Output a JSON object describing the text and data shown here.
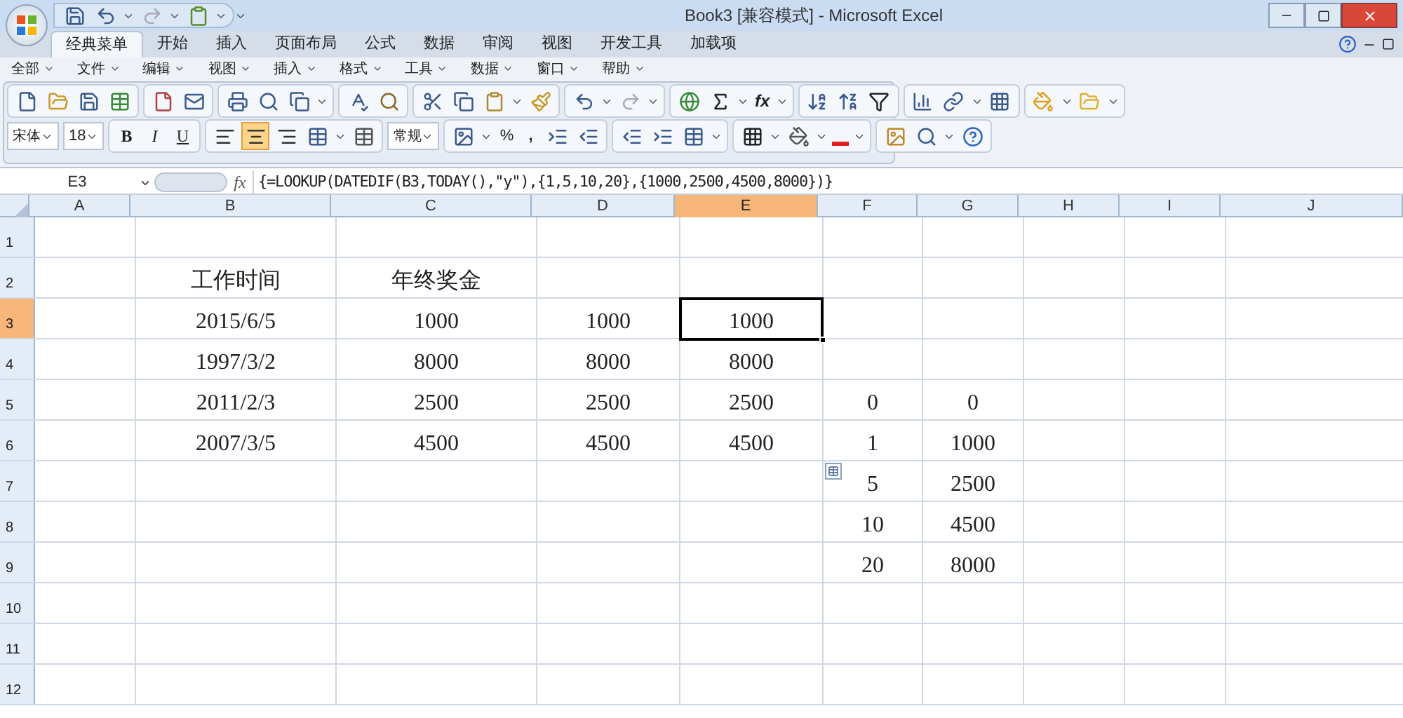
{
  "window": {
    "title": "Book3  [兼容模式] - Microsoft Excel"
  },
  "tabs": [
    {
      "label": "经典菜单",
      "selected": true
    },
    {
      "label": "开始",
      "selected": false
    },
    {
      "label": "插入",
      "selected": false
    },
    {
      "label": "页面布局",
      "selected": false
    },
    {
      "label": "公式",
      "selected": false
    },
    {
      "label": "数据",
      "selected": false
    },
    {
      "label": "审阅",
      "selected": false
    },
    {
      "label": "视图",
      "selected": false
    },
    {
      "label": "开发工具",
      "selected": false
    },
    {
      "label": "加载项",
      "selected": false
    }
  ],
  "menu": [
    "全部",
    "文件",
    "编辑",
    "视图",
    "插入",
    "格式",
    "工具",
    "数据",
    "窗口",
    "帮助"
  ],
  "format_bar": {
    "function_button": "fx",
    "font": "宋体",
    "size": "18",
    "bold": "B",
    "italic": "I",
    "underline": "U",
    "number_format": "常规",
    "percent": "%",
    "comma": ","
  },
  "formula_bar": {
    "name_box": "E3",
    "fx": "fx",
    "formula": "{=LOOKUP(DATEDIF(B3,TODAY(),\"y\"),{1,5,10,20},{1000,2500,4500,8000})}"
  },
  "columns": [
    {
      "label": "A",
      "selected": false
    },
    {
      "label": "B",
      "selected": false
    },
    {
      "label": "C",
      "selected": false
    },
    {
      "label": "D",
      "selected": false
    },
    {
      "label": "E",
      "selected": true
    },
    {
      "label": "F",
      "selected": false
    },
    {
      "label": "G",
      "selected": false
    },
    {
      "label": "H",
      "selected": false
    },
    {
      "label": "I",
      "selected": false
    },
    {
      "label": "J",
      "selected": false
    }
  ],
  "rows": [
    {
      "header": "1",
      "selected": false,
      "cells": [
        null,
        null,
        null,
        null,
        null,
        null,
        null,
        null,
        null,
        null
      ]
    },
    {
      "header": "2",
      "selected": false,
      "cells": [
        null,
        "工作时间",
        "年终奖金",
        null,
        null,
        null,
        null,
        null,
        null,
        null
      ]
    },
    {
      "header": "3",
      "selected": true,
      "cells": [
        null,
        "2015/6/5",
        "1000",
        "1000",
        "1000",
        null,
        null,
        null,
        null,
        null
      ]
    },
    {
      "header": "4",
      "selected": false,
      "cells": [
        null,
        "1997/3/2",
        "8000",
        "8000",
        "8000",
        null,
        null,
        null,
        null,
        null
      ]
    },
    {
      "header": "5",
      "selected": false,
      "cells": [
        null,
        "2011/2/3",
        "2500",
        "2500",
        "2500",
        "0",
        "0",
        null,
        null,
        null
      ]
    },
    {
      "header": "6",
      "selected": false,
      "cells": [
        null,
        "2007/3/5",
        "4500",
        "4500",
        "4500",
        "1",
        "1000",
        null,
        null,
        null
      ]
    },
    {
      "header": "7",
      "selected": false,
      "cells": [
        null,
        null,
        null,
        null,
        null,
        "5",
        "2500",
        null,
        null,
        null
      ]
    },
    {
      "header": "8",
      "selected": false,
      "cells": [
        null,
        null,
        null,
        null,
        null,
        "10",
        "4500",
        null,
        null,
        null
      ]
    },
    {
      "header": "9",
      "selected": false,
      "cells": [
        null,
        null,
        null,
        null,
        null,
        "20",
        "8000",
        null,
        null,
        null
      ]
    },
    {
      "header": "10",
      "selected": false,
      "cells": [
        null,
        null,
        null,
        null,
        null,
        null,
        null,
        null,
        null,
        null
      ]
    },
    {
      "header": "11",
      "selected": false,
      "cells": [
        null,
        null,
        null,
        null,
        null,
        null,
        null,
        null,
        null,
        null
      ]
    },
    {
      "header": "12",
      "selected": false,
      "cells": [
        null,
        null,
        null,
        null,
        null,
        null,
        null,
        null,
        null,
        null
      ]
    }
  ]
}
